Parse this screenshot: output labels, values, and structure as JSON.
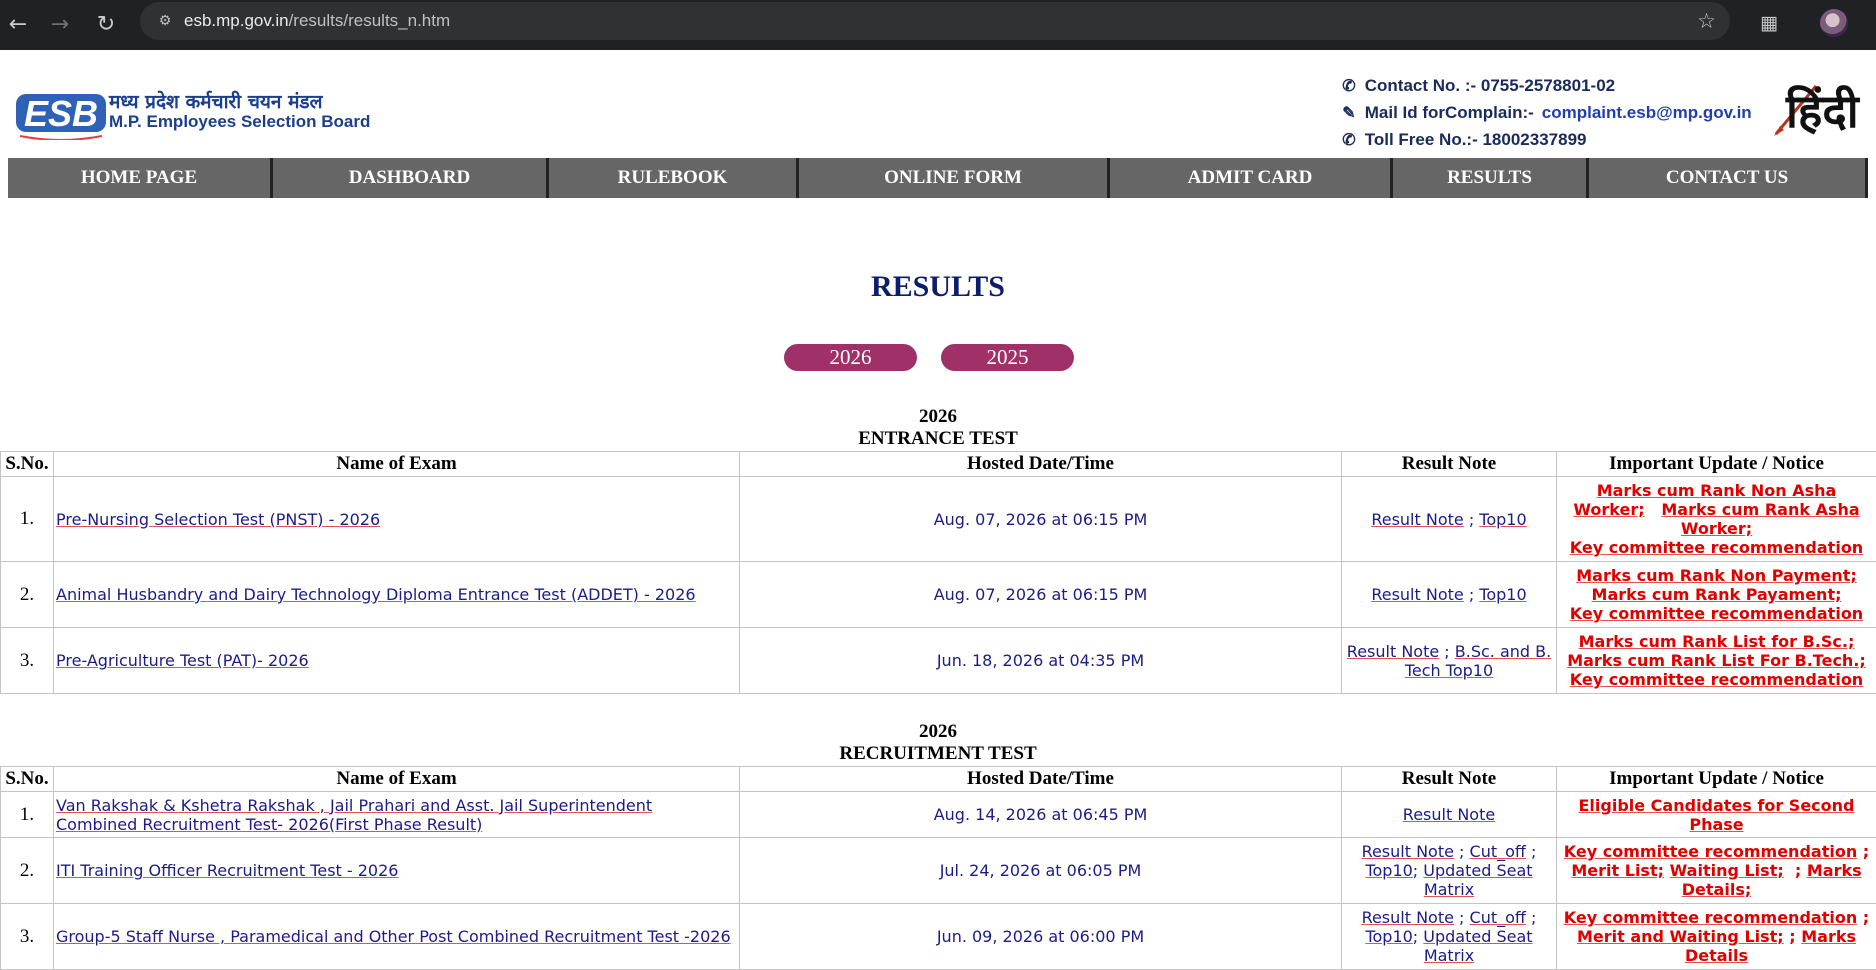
{
  "browser": {
    "url_host": "esb.mp.gov.in",
    "url_path": "/results/results_n.htm"
  },
  "header": {
    "logo_hindi": "मध्य प्रदेश कर्मचारी चयन मंडल",
    "logo_english": "M.P. Employees Selection Board",
    "contact_no": "Contact No. :- 0755-2578801-02",
    "mail_label": "Mail Id forComplain:-",
    "mail_value": "complaint.esb@mp.gov.in",
    "toll_free": "Toll Free No.:- 18002337899",
    "hindi_link": "हिंदी"
  },
  "menu": [
    "HOME PAGE",
    "DASHBOARD",
    "RULEBOOK",
    "ONLINE FORM",
    "ADMIT CARD",
    "RESULTS",
    "CONTACT US"
  ],
  "page_title": "RESULTS",
  "years": [
    "2026",
    "2025"
  ],
  "columns": [
    "S.No.",
    "Name of Exam",
    "Hosted Date/Time",
    "Result Note",
    "Important Update / Notice"
  ],
  "entrance": {
    "year": "2026",
    "title": "ENTRANCE TEST",
    "rows": [
      {
        "sno": "1.",
        "exam": "Pre-Nursing Selection Test (PNST) - 2026",
        "date": "Aug. 07, 2026 at 06:15 PM",
        "note_1": "Result Note",
        "note_2": "Top10",
        "upd_1": "Marks cum Rank Non Asha Worker;",
        "upd_2": "Marks cum Rank Asha Worker;",
        "upd_3": "Key committee recommendation"
      },
      {
        "sno": "2.",
        "exam": "Animal Husbandry and Dairy Technology Diploma Entrance Test (ADDET) - 2026",
        "date": "Aug. 07, 2026 at 06:15 PM",
        "note_1": "Result Note",
        "note_2": "Top10",
        "upd_1": "Marks cum Rank Non Payment;",
        "upd_2": "Marks cum Rank Payament;",
        "upd_3": "Key committee recommendation"
      },
      {
        "sno": "3.",
        "exam": "Pre-Agriculture Test (PAT)- 2026",
        "date": "Jun. 18, 2026 at 04:35 PM",
        "note_1": "Result Note",
        "note_2": "B.Sc. and B. Tech Top10",
        "upd_1": "Marks cum Rank List for B.Sc.;",
        "upd_2": "Marks cum Rank List For B.Tech.;",
        "upd_3": "Key committee recommendation"
      }
    ]
  },
  "recruitment": {
    "year": "2026",
    "title": "RECRUITMENT TEST",
    "rows": [
      {
        "sno": "1.",
        "exam": "Van Rakshak & Kshetra Rakshak , Jail Prahari and Asst. Jail Superintendent Combined Recruitment Test- 2026(First Phase Result)",
        "date": "Aug. 14, 2026 at 06:45 PM",
        "note_1": "Result Note",
        "upd_1": "Eligible Candidates for Second Phase"
      },
      {
        "sno": "2.",
        "exam": "ITI Training Officer Recruitment Test - 2026",
        "date": "Jul. 24, 2026 at 06:05 PM",
        "note_1": "Result Note",
        "note_2": "Cut_off",
        "note_3": "Top10",
        "note_4": "Updated Seat Matrix",
        "upd_1": "Key committee recommendation",
        "upd_2": "Merit List;",
        "upd_3": "Waiting List;",
        "upd_4": "Marks Details;"
      },
      {
        "sno": "3.",
        "exam": "Group-5 Staff Nurse , Paramedical and Other Post Combined Recruitment Test -2026",
        "date": "Jun. 09, 2026 at 06:00 PM",
        "note_1": "Result Note",
        "note_2": "Cut_off",
        "note_3": "Top10",
        "note_4": "Updated Seat Matrix",
        "upd_1": "Key committee recommendation",
        "upd_2": "Merit and Waiting List;",
        "upd_3": "Marks Details"
      }
    ]
  }
}
